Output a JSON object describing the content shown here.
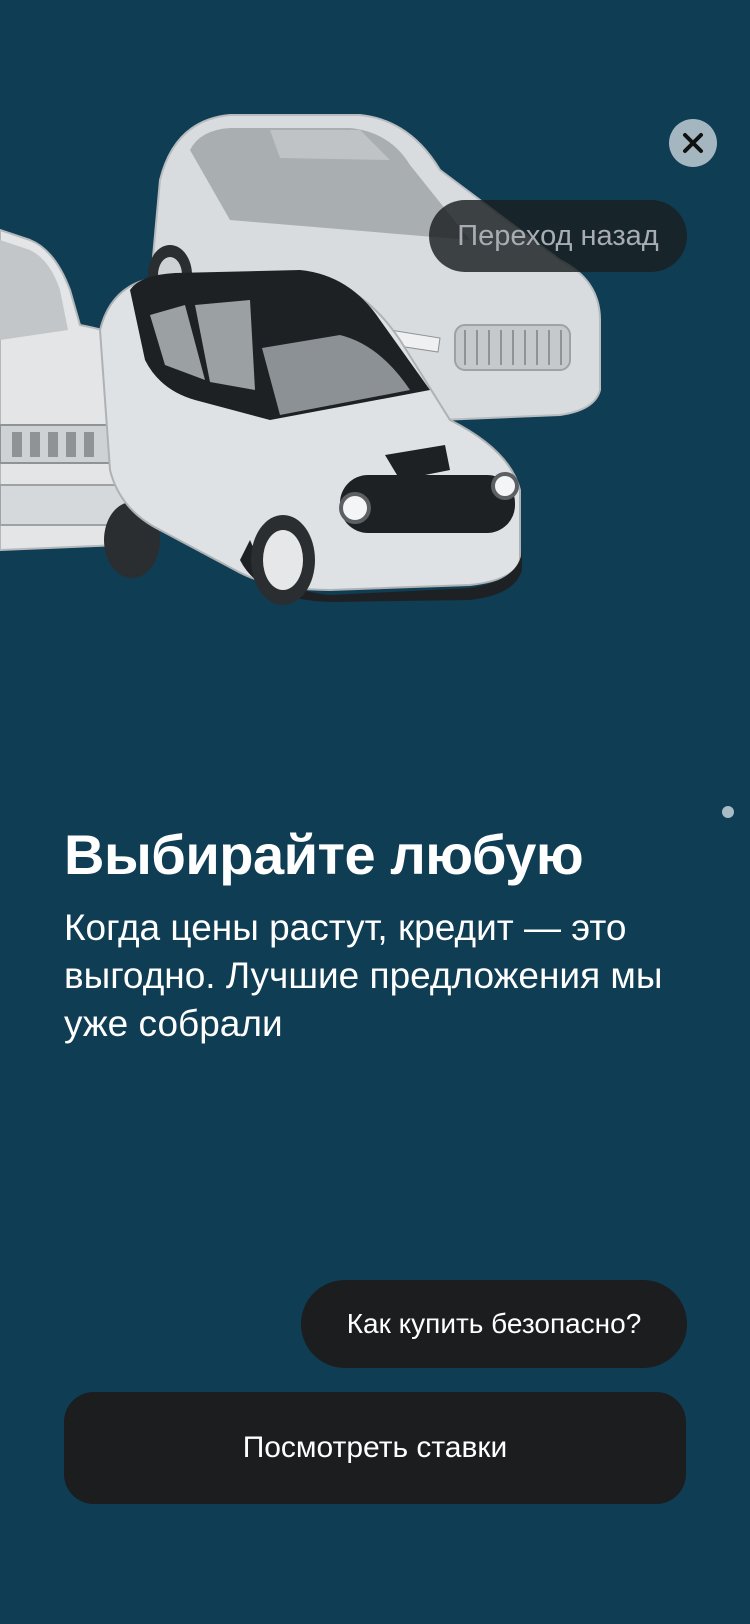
{
  "hero": {
    "image_name": "cars-illustration"
  },
  "close": {
    "icon": "close-icon"
  },
  "tooltip": {
    "back_label": "Переход назад"
  },
  "content": {
    "title": "Выбирайте любую",
    "subtitle": "Когда цены растут, кредит — это выгодно. Лучшие предложения мы уже собрали"
  },
  "actions": {
    "safe_purchase_label": "Как купить безопасно?",
    "view_rates_label": "Посмотреть ставки"
  },
  "colors": {
    "background": "#0f3d54",
    "button": "#1b1d1f",
    "text": "#ffffff"
  }
}
